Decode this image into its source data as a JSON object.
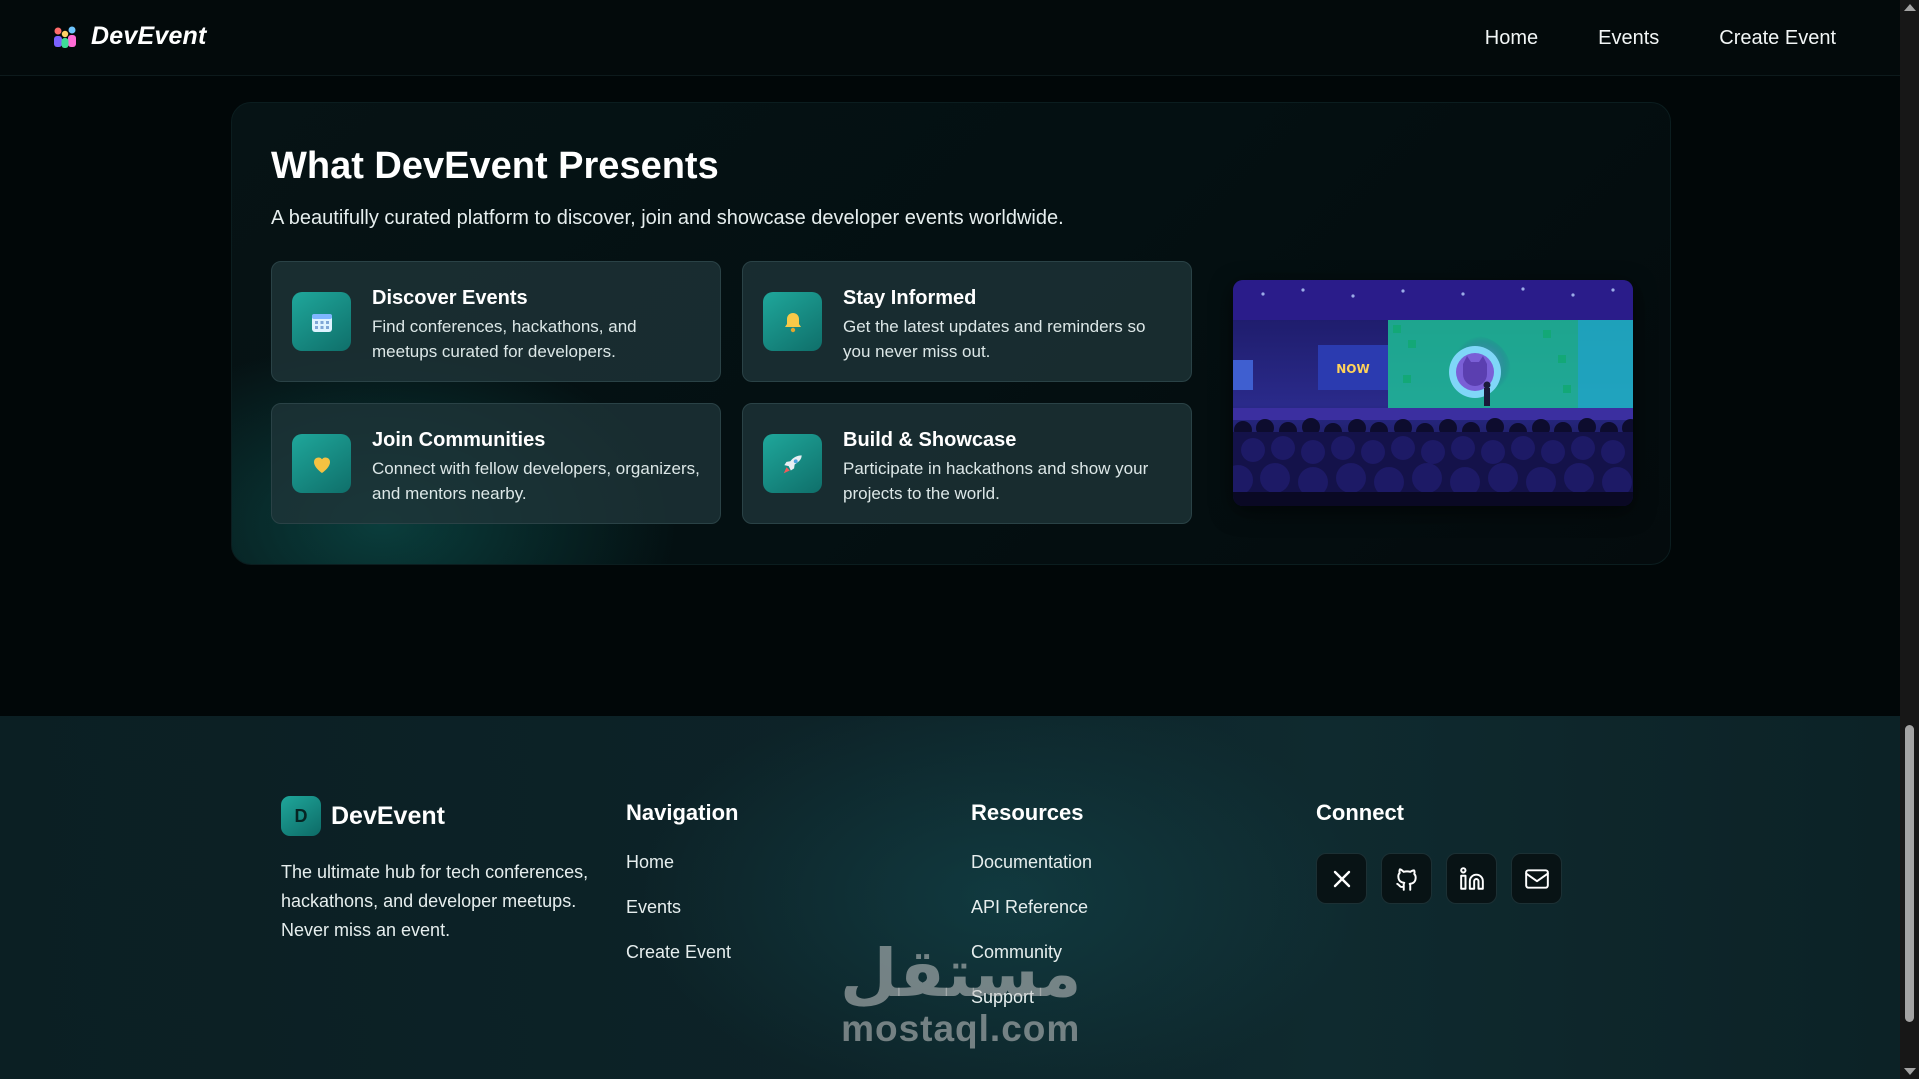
{
  "header": {
    "brand": "DevEvent",
    "nav": [
      "Home",
      "Events",
      "Create Event"
    ]
  },
  "features": {
    "title": "What DevEvent Presents",
    "subtitle": "A beautifully curated platform to discover, join and showcase developer events worldwide.",
    "cards": [
      {
        "icon": "calendar-icon",
        "title": "Discover Events",
        "desc": "Find conferences, hackathons, and meetups curated for developers."
      },
      {
        "icon": "bell-icon",
        "title": "Stay Informed",
        "desc": "Get the latest updates and reminders so you never miss out."
      },
      {
        "icon": "heart-icon",
        "title": "Join Communities",
        "desc": "Connect with fellow developers, organizers, and mentors nearby."
      },
      {
        "icon": "rocket-icon",
        "title": "Build & Showcase",
        "desc": "Participate in hackathons and show your projects to the world."
      }
    ],
    "photo_screen_text": "NOW"
  },
  "footer": {
    "brand_letter": "D",
    "brand": "DevEvent",
    "tagline": "The ultimate hub for tech conferences, hackathons, and developer meetups. Never miss an event.",
    "navigation": {
      "title": "Navigation",
      "links": [
        "Home",
        "Events",
        "Create Event"
      ]
    },
    "resources": {
      "title": "Resources",
      "links": [
        "Documentation",
        "API Reference",
        "Community",
        "Support"
      ]
    },
    "connect": {
      "title": "Connect",
      "icons": [
        "x-icon",
        "github-icon",
        "linkedin-icon",
        "mail-icon"
      ]
    }
  },
  "watermark": {
    "arabic": "مستقل",
    "latin": "mostaql.com"
  },
  "colors": {
    "accent": "#1fa79b",
    "background": "#010708",
    "footer": "#0d2328"
  }
}
